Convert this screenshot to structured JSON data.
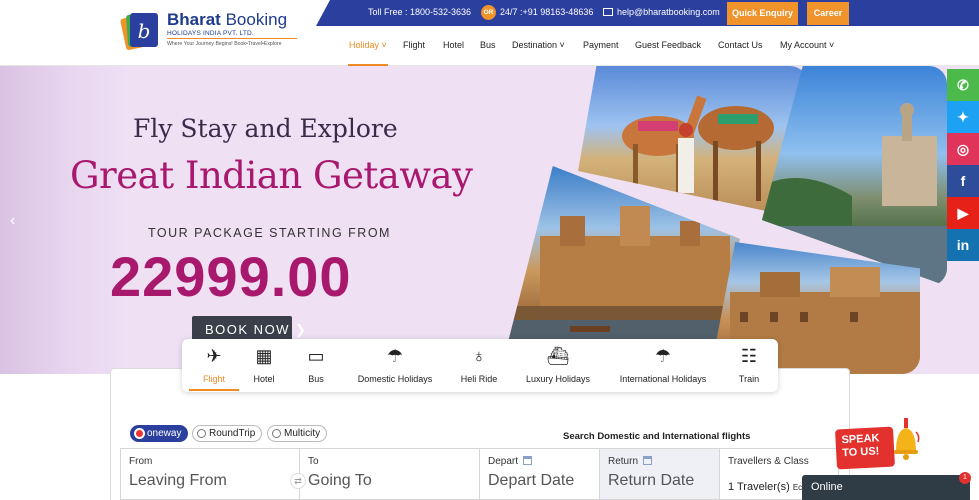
{
  "brand": {
    "name_bold": "Bharat",
    "name_regular": "Booking",
    "subtitle": "HOLIDAYS INDIA PVT. LTD.",
    "tagline": "Where Your Journey Begins! Book•Travel•Explore"
  },
  "topbar": {
    "tollfree": "Toll Free : 1800-532-3636",
    "or_badge": "OR",
    "phone": "24/7 :+91 98163-48636",
    "email": "help@bharatbooking.com",
    "quick_enquiry": "Quick Enquiry",
    "career": "Career"
  },
  "nav": {
    "items": [
      {
        "label": "Holiday ˅",
        "active": true
      },
      {
        "label": "Flight"
      },
      {
        "label": "Hotel"
      },
      {
        "label": "Bus"
      },
      {
        "label": "Destination ˅"
      },
      {
        "label": "Payment"
      },
      {
        "label": "Guest Feedback"
      },
      {
        "label": "Contact Us"
      },
      {
        "label": "My Account ˅"
      }
    ]
  },
  "hero": {
    "tagline": "Fly Stay and Explore",
    "title": "Great Indian Getaway",
    "from_label": "TOUR PACKAGE STARTING FROM",
    "price": "22999.00",
    "cta": "BOOK NOW ❯",
    "prev_arrow": "‹"
  },
  "social": [
    {
      "icon": "whatsapp-icon",
      "glyph": "✆",
      "color": "#4bba4b"
    },
    {
      "icon": "twitter-icon",
      "glyph": "✦",
      "color": "#1da1f2"
    },
    {
      "icon": "instagram-icon",
      "glyph": "◎",
      "color": "#e0345a"
    },
    {
      "icon": "facebook-icon",
      "glyph": "f",
      "color": "#2d4d9a"
    },
    {
      "icon": "youtube-icon",
      "glyph": "▶",
      "color": "#e62117"
    },
    {
      "icon": "linkedin-icon",
      "glyph": "in",
      "color": "#1472b0"
    }
  ],
  "categories": [
    {
      "label": "Flight",
      "icon": "airplane-icon",
      "glyph": "✈",
      "active": true
    },
    {
      "label": "Hotel",
      "icon": "hotel-icon",
      "glyph": "▦"
    },
    {
      "label": "Bus",
      "icon": "bus-icon",
      "glyph": "▭"
    },
    {
      "label": "Domestic Holidays",
      "icon": "beach-umbrella-icon",
      "glyph": "☂"
    },
    {
      "label": "Heli Ride",
      "icon": "helicopter-icon",
      "glyph": "♁"
    },
    {
      "label": "Luxury Holidays",
      "icon": "cruise-ship-icon",
      "glyph": "⛴"
    },
    {
      "label": "International Holidays",
      "icon": "beach-umbrella-icon",
      "glyph": "☂"
    },
    {
      "label": "Train",
      "icon": "train-icon",
      "glyph": "☷"
    }
  ],
  "search": {
    "trip_types": [
      {
        "label": "oneway",
        "selected": true
      },
      {
        "label": "RoundTrip"
      },
      {
        "label": "Multicity"
      }
    ],
    "title": "Search Domestic and International flights",
    "from_label": "From",
    "from_placeholder": "Leaving From",
    "to_label": "To",
    "to_placeholder": "Going To",
    "depart_label": "Depart",
    "depart_placeholder": "Depart Date",
    "return_label": "Return",
    "return_placeholder": "Return Date",
    "travellers_label": "Travellers & Class",
    "travellers_value": "1 Traveler(s)",
    "class_value": "Eco"
  },
  "speak": {
    "line1": "SPEAK",
    "line2": "TO US!"
  },
  "chat": {
    "status": "Online",
    "badge": "1"
  }
}
